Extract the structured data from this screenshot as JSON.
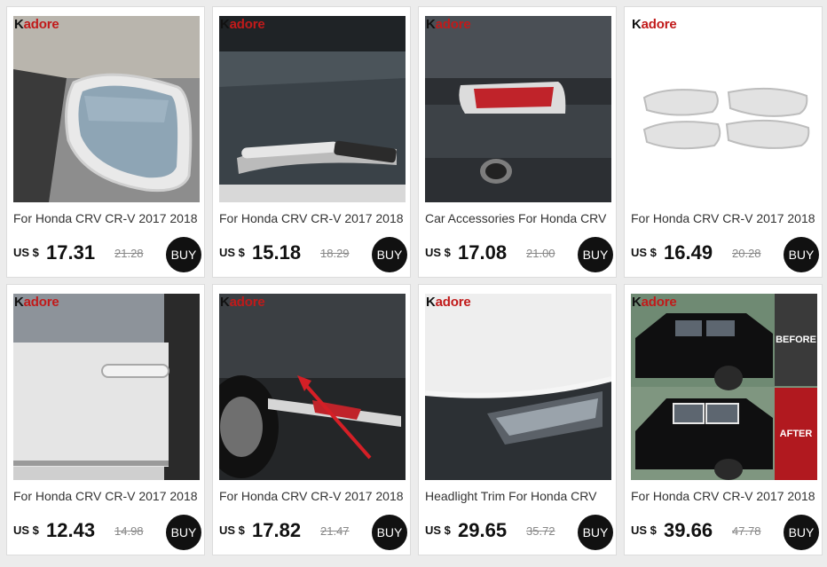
{
  "brand": {
    "prefix": "K",
    "rest": "adore"
  },
  "currency": "US $",
  "buy_label": "BUY",
  "products": [
    {
      "title": "For Honda CRV CR-V 2017 2018",
      "price": "17.31",
      "old_price": "21.28",
      "image": "chrome mirror cover",
      "logo": true
    },
    {
      "title": "For Honda CRV CR-V 2017 2018",
      "price": "15.18",
      "old_price": "18.29",
      "image": "rear wiper trim",
      "logo": true
    },
    {
      "title": "Car Accessories For Honda CRV",
      "price": "17.08",
      "old_price": "21.00",
      "image": "rear fog lamp trim",
      "logo": true
    },
    {
      "title": "For Honda CRV CR-V 2017 2018",
      "price": "16.49",
      "old_price": "20.28",
      "image": "door bowl covers",
      "logo": true
    },
    {
      "title": "For Honda CRV CR-V 2017 2018",
      "price": "12.43",
      "old_price": "14.98",
      "image": "door handle cover",
      "logo": true
    },
    {
      "title": "For Honda CRV CR-V 2017 2018",
      "price": "17.82",
      "old_price": "21.47",
      "image": "rear bumper trim",
      "logo": true
    },
    {
      "title": "Headlight Trim For Honda CRV",
      "price": "29.65",
      "old_price": "35.72",
      "image": "headlight trim",
      "logo": true
    },
    {
      "title": "For Honda CRV CR-V 2017 2018",
      "price": "39.66",
      "old_price": "47.78",
      "image": "window trim before after",
      "logo": true,
      "before_label": "BEFORE",
      "after_label": "AFTER"
    }
  ]
}
